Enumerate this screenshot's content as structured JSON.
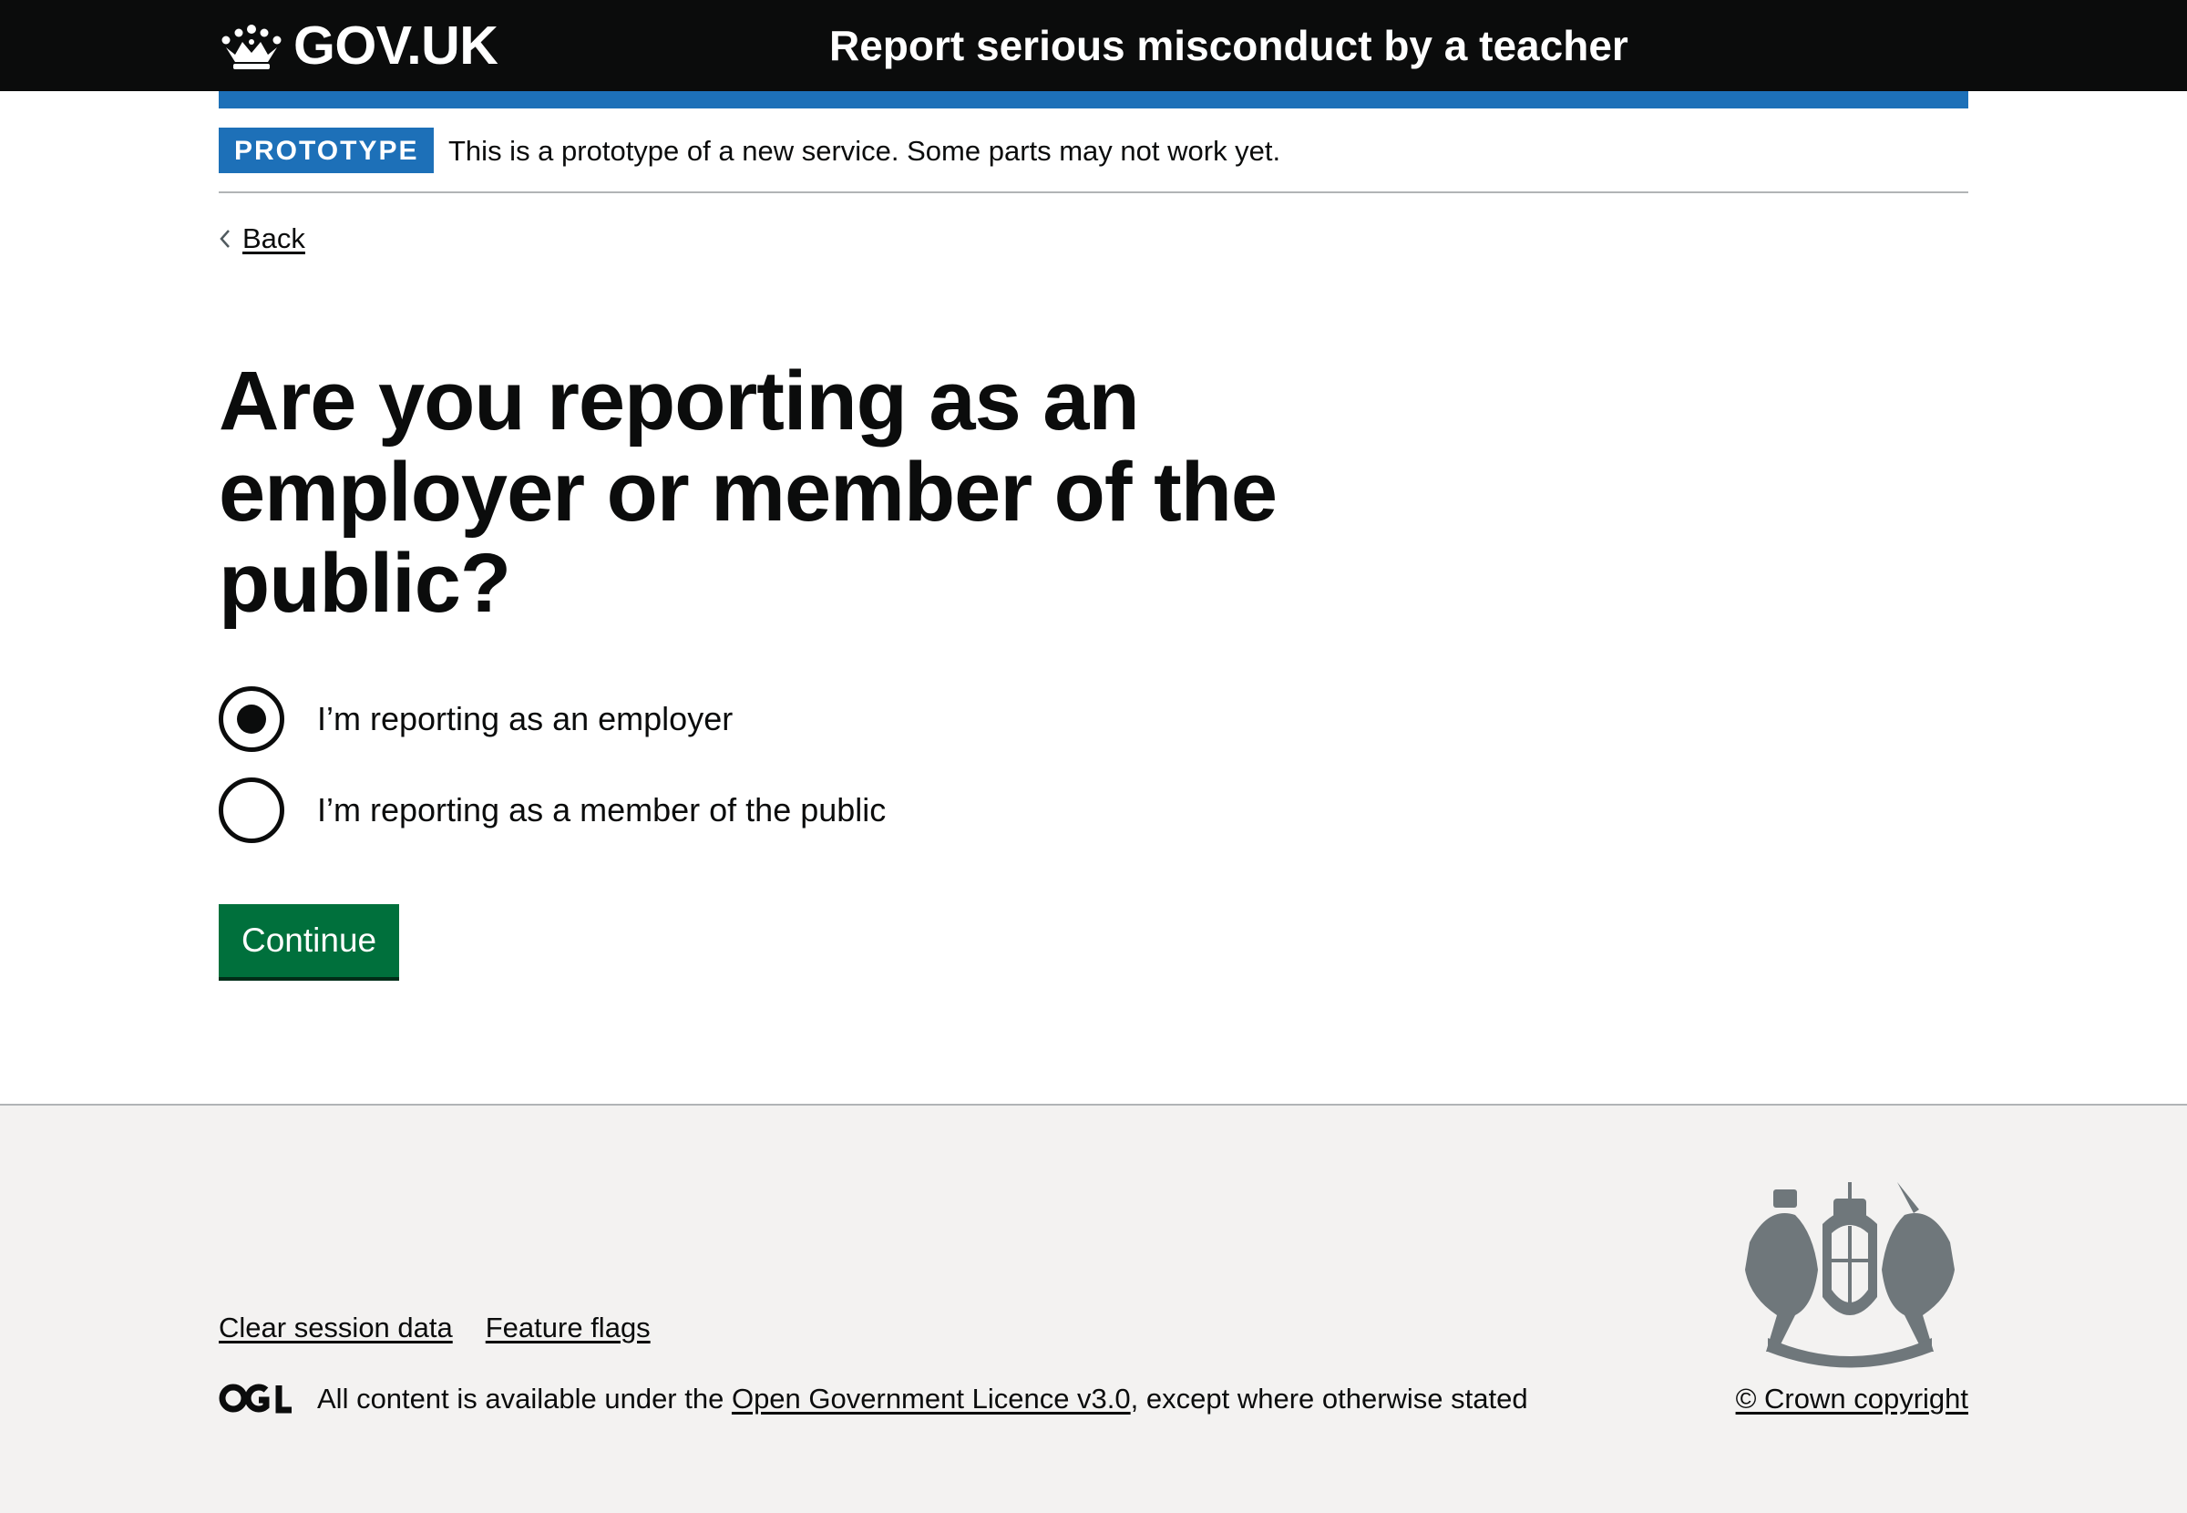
{
  "header": {
    "logo_text": "GOV.UK",
    "service_name": "Report serious misconduct by a teacher"
  },
  "phase_banner": {
    "tag": "PROTOTYPE",
    "text": "This is a prototype of a new service. Some parts may not work yet."
  },
  "back_link": "Back",
  "question": {
    "heading": "Are you reporting as an employer or member of the public?",
    "options": [
      {
        "label": "I’m reporting as an employer",
        "selected": true
      },
      {
        "label": "I’m reporting as a member of the public",
        "selected": false
      }
    ]
  },
  "continue_label": "Continue",
  "footer": {
    "links": [
      "Clear session data",
      "Feature flags"
    ],
    "licence_prefix": "All content is available under the ",
    "licence_link": "Open Government Licence v3.0",
    "licence_suffix": ", except where otherwise stated",
    "copyright": "© Crown copyright"
  },
  "colors": {
    "header_bg": "#0b0c0c",
    "brand_blue": "#1d70b8",
    "button_green": "#00703c",
    "footer_bg": "#f3f2f1"
  },
  "icons": [
    "crown-icon",
    "chevron-left-icon",
    "ogl-logo-icon",
    "royal-coat-of-arms-icon"
  ]
}
